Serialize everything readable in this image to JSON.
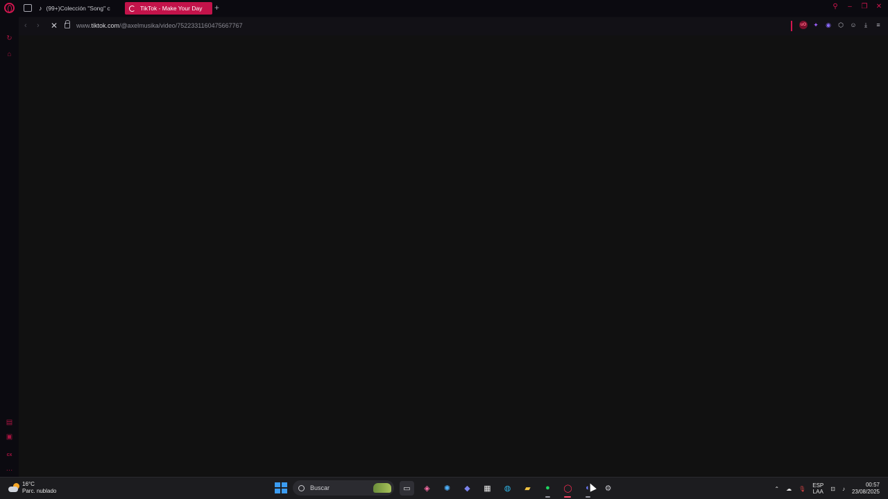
{
  "browser": {
    "tabs": [
      {
        "label": "(99+)Colección \"Song\" c",
        "icon": "tiktok-icon",
        "active": false
      },
      {
        "label": "TikTok - Make Your Day",
        "icon": "loading-spinner-icon",
        "active": true
      }
    ],
    "new_tab_glyph": "+",
    "address": {
      "prefix": "www.",
      "domain": "tiktok.com",
      "path": "/@axelmusika/video/7522331160475667767"
    },
    "accent_color": "#d2164f",
    "active_tab_color": "#c3134a"
  },
  "sidebar": {
    "icons": [
      "history-icon",
      "wallet-icon",
      "calendar-icon",
      "app-icon",
      "cx-icon",
      "more-icon"
    ]
  },
  "taskbar": {
    "weather": {
      "temp": "16°C",
      "condition": "Parc. nublado"
    },
    "search_placeholder": "Buscar",
    "apps": [
      "file-explorer-icon",
      "copilot-icon",
      "edge-chat-icon",
      "teams-icon",
      "store-icon",
      "edge-icon",
      "folder-icon",
      "spotify-icon",
      "opera-gx-icon",
      "discord-icon",
      "settings-icon"
    ],
    "language": {
      "top": "ESP",
      "bottom": "LAA"
    },
    "clock": {
      "time": "00:57",
      "date": "23/08/2025"
    }
  }
}
